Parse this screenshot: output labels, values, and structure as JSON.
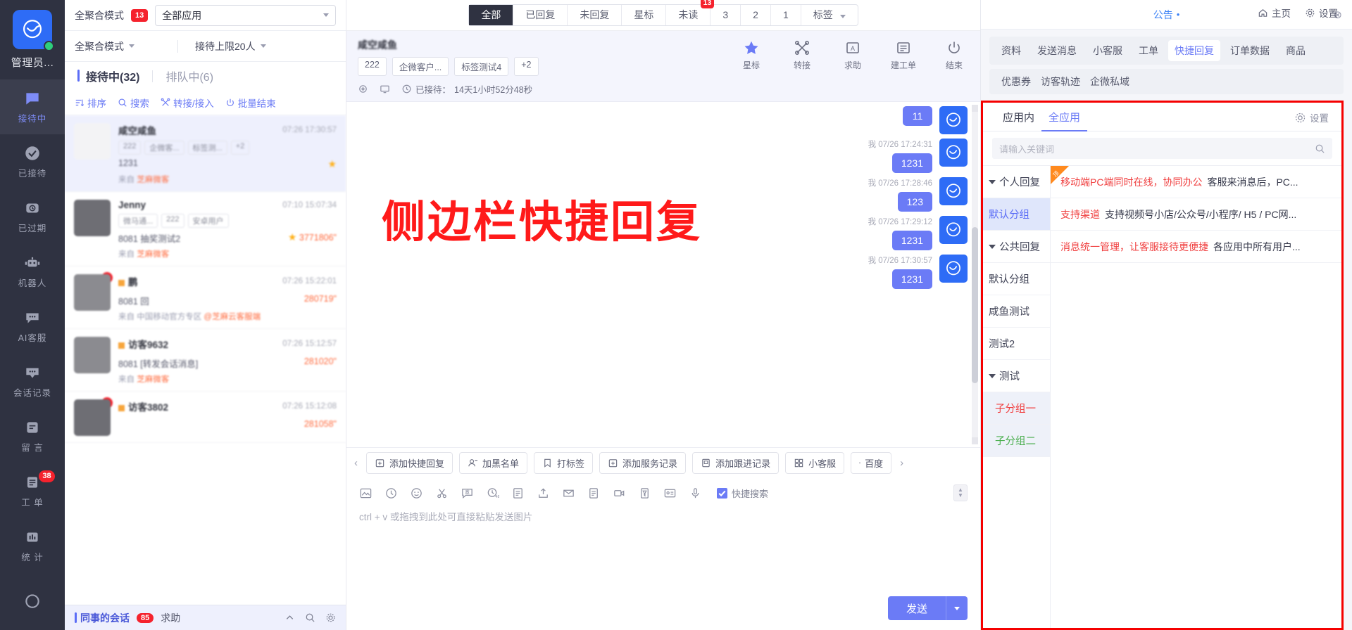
{
  "rail": {
    "user": "管理员...",
    "items": [
      {
        "label": "接待中",
        "icon": "chat-active-icon",
        "active": true,
        "badge": ""
      },
      {
        "label": "已接待",
        "icon": "check-circle-icon",
        "active": false,
        "badge": ""
      },
      {
        "label": "已过期",
        "icon": "clock-box-icon",
        "active": false,
        "badge": ""
      },
      {
        "label": "机器人",
        "icon": "robot-icon",
        "active": false,
        "badge": ""
      },
      {
        "label": "AI客服",
        "icon": "ai-chat-icon",
        "active": false,
        "badge": ""
      },
      {
        "label": "会话记录",
        "icon": "chat-history-icon",
        "active": false,
        "badge": ""
      },
      {
        "label": "留 言",
        "icon": "message-board-icon",
        "active": false,
        "badge": ""
      },
      {
        "label": "工 单",
        "icon": "ticket-icon",
        "active": false,
        "badge": "38"
      },
      {
        "label": "统 计",
        "icon": "stats-icon",
        "active": false,
        "badge": ""
      }
    ]
  },
  "topright": {
    "home": "主页",
    "settings": "设置"
  },
  "conv": {
    "mode_label": "全聚合模式",
    "mode_badge": "13",
    "app_select": "全部应用",
    "mode_dropdown": "全聚合模式",
    "limit": "接待上限20人",
    "tabs": [
      {
        "label": "接待中(32)",
        "active": true
      },
      {
        "label": "排队中(6)",
        "active": false
      }
    ],
    "actions": [
      {
        "label": "排序",
        "icon": "sort-icon"
      },
      {
        "label": "搜索",
        "icon": "search-icon"
      },
      {
        "label": "转接/接入",
        "icon": "transfer-icon"
      },
      {
        "label": "批量结束",
        "icon": "power-icon"
      }
    ],
    "items": [
      {
        "name": "咸空咸鱼",
        "time": "07:26 17:30:57",
        "tags": [
          "222",
          "企微客...",
          "标签测...",
          "+2"
        ],
        "message": "1231",
        "from_label": "来自",
        "from_value": "芝麻微客",
        "starred": true,
        "selected": true,
        "unread": "",
        "avatar": "light",
        "flag": false
      },
      {
        "name": "Jenny",
        "time": "07:10 15:07:34",
        "tags": [
          "微马通...",
          "222",
          "安卓用户"
        ],
        "message": "8081 抽奖测试2",
        "msg_right": "3771806\"",
        "from_label": "来自",
        "from_value": "芝麻微客",
        "starred": true,
        "selected": false,
        "unread": "",
        "avatar": "dark",
        "flag": false
      },
      {
        "name": "鹏",
        "time": "07:26 15:22:01",
        "tags": [],
        "message": "8081 回",
        "msg_right": "280719\"",
        "from_label": "来自",
        "from_value": "中国移动官方专区",
        "from_extra": "@芝麻云客服端",
        "starred": false,
        "selected": false,
        "unread": "1",
        "avatar": "dark2",
        "flag": true
      },
      {
        "name": "访客9632",
        "time": "07:26 15:12:57",
        "tags": [],
        "message": "8081 [转发会话消息]",
        "msg_right": "281020\"",
        "from_label": "来自",
        "from_value": "芝麻微客",
        "starred": false,
        "selected": false,
        "unread": "",
        "avatar": "dark2",
        "flag": true
      },
      {
        "name": "访客3802",
        "time": "07:26 15:12:08",
        "tags": [],
        "message": "",
        "msg_right": "281058\"",
        "from_label": "",
        "from_value": "",
        "starred": false,
        "selected": false,
        "unread": "1",
        "avatar": "dark",
        "flag": true
      }
    ],
    "bottom": {
      "colleague_label": "同事的会话",
      "colleague_count": "85",
      "help_label": "求助"
    }
  },
  "chat": {
    "filters": [
      {
        "label": "全部",
        "active": true,
        "badge": ""
      },
      {
        "label": "已回复",
        "active": false,
        "badge": ""
      },
      {
        "label": "未回复",
        "active": false,
        "badge": ""
      },
      {
        "label": "星标",
        "active": false,
        "badge": ""
      },
      {
        "label": "未读",
        "active": false,
        "badge": "13"
      },
      {
        "label": "3",
        "active": false,
        "badge": ""
      },
      {
        "label": "2",
        "active": false,
        "badge": ""
      },
      {
        "label": "1",
        "active": false,
        "badge": ""
      },
      {
        "label": "标签",
        "active": false,
        "badge": "",
        "caret": true
      }
    ],
    "header": {
      "name": "咸空咸鱼",
      "tags": [
        "222",
        "企微客户...",
        "标签测试4",
        "+2"
      ],
      "duration_label": "已接待：",
      "duration_value": "14天1小时52分48秒",
      "actions": [
        {
          "label": "星标",
          "icon": "star-icon"
        },
        {
          "label": "转接",
          "icon": "transfer-icon"
        },
        {
          "label": "求助",
          "icon": "help-book-icon"
        },
        {
          "label": "建工单",
          "icon": "ticket-list-icon"
        },
        {
          "label": "结束",
          "icon": "power-icon"
        }
      ]
    },
    "messages": [
      {
        "sender": "我",
        "time": "",
        "text": "11"
      },
      {
        "sender": "我",
        "time": "我  07/26 17:24:31",
        "text": "1231"
      },
      {
        "sender": "我",
        "time": "我  07/26 17:28:46",
        "text": "123"
      },
      {
        "sender": "我",
        "time": "我  07/26 17:29:12",
        "text": "1231"
      },
      {
        "sender": "我",
        "time": "我  07/26 17:30:57",
        "text": "1231"
      }
    ],
    "watermark": "侧边栏快捷回复",
    "quickbuttons": [
      {
        "label": "添加快捷回复",
        "icon": "add-box-icon"
      },
      {
        "label": "加黑名单",
        "icon": "user-block-icon"
      },
      {
        "label": "打标签",
        "icon": "tag-icon"
      },
      {
        "label": "添加服务记录",
        "icon": "add-record-icon"
      },
      {
        "label": "添加跟进记录",
        "icon": "follow-record-icon"
      },
      {
        "label": "小客服",
        "icon": "grid-icon"
      },
      {
        "label": "百度",
        "icon": "grid-icon"
      }
    ],
    "tools": [
      "image-icon",
      "history-icon",
      "emoji-icon",
      "scissors-icon",
      "invite-icon",
      "timer-48-icon",
      "document-icon",
      "upload-icon",
      "inbox-icon",
      "form-icon",
      "video-icon",
      "filter-icon",
      "card-icon",
      "mic-icon"
    ],
    "quick_search_label": "快捷搜索",
    "input_placeholder": "ctrl + v 或拖拽到此处可直接粘贴发送图片",
    "send_label": "发送"
  },
  "right": {
    "announce": "公告",
    "tabs_row1": [
      {
        "label": "资料",
        "on": false
      },
      {
        "label": "发送消息",
        "on": false
      },
      {
        "label": "小客服",
        "on": false
      },
      {
        "label": "工单",
        "on": false
      },
      {
        "label": "快捷回复",
        "on": true
      },
      {
        "label": "订单数据",
        "on": false
      },
      {
        "label": "商品",
        "on": false
      }
    ],
    "tabs_row2": [
      "优惠券",
      "访客轨迹",
      "企微私域"
    ],
    "quickreply": {
      "tabs": [
        {
          "label": "应用内",
          "on": false
        },
        {
          "label": "全应用",
          "on": true
        }
      ],
      "settings_label": "设置",
      "search_placeholder": "请输入关键词",
      "groups": [
        {
          "label": "个人回复",
          "type": "parent",
          "expanded": true
        },
        {
          "label": "默认分组",
          "type": "leaf",
          "selected": true
        },
        {
          "label": "公共回复",
          "type": "parent",
          "expanded": true
        },
        {
          "label": "默认分组",
          "type": "leaf"
        },
        {
          "label": "咸鱼测试",
          "type": "leaf"
        },
        {
          "label": "测试2",
          "type": "leaf"
        },
        {
          "label": "测试",
          "type": "parent",
          "expanded": true
        },
        {
          "label": "子分组一",
          "type": "child",
          "color": "red"
        },
        {
          "label": "子分组二",
          "type": "child",
          "color": "green"
        }
      ],
      "items": [
        {
          "key": "移动端PC端同时在线，协同办公",
          "value": "客服来消息后，PC...",
          "top": true
        },
        {
          "key": "支持渠道",
          "value": "支持视频号小店/公众号/小程序/ H5 / PC网...",
          "top": false
        },
        {
          "key": "消息统一管理，让客服接待更便捷",
          "value": "各应用中所有用户...",
          "top": false
        }
      ]
    }
  },
  "colors": {
    "accent": "#6b7bf6",
    "danger": "#f5222d",
    "rail_bg": "#2f3241",
    "highlight_border": "#f50000"
  }
}
